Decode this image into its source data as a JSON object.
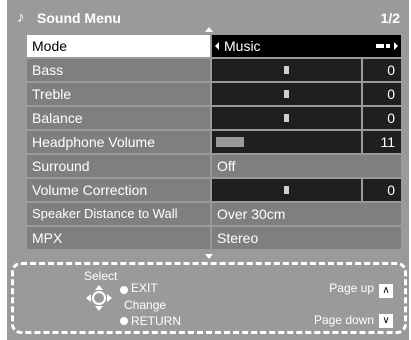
{
  "header": {
    "title": "Sound Menu",
    "page": "1/2",
    "icon": "music-note-icon"
  },
  "menu": {
    "mode": {
      "label": "Mode",
      "value": "Music"
    },
    "bass": {
      "label": "Bass",
      "value": "0"
    },
    "treble": {
      "label": "Treble",
      "value": "0"
    },
    "balance": {
      "label": "Balance",
      "value": "0"
    },
    "headphone": {
      "label": "Headphone Volume",
      "value": "11"
    },
    "surround": {
      "label": "Surround",
      "value": "Off"
    },
    "volcorr": {
      "label": "Volume Correction",
      "value": "0"
    },
    "speaker": {
      "label": "Speaker Distance to Wall",
      "value": "Over 30cm"
    },
    "mpx": {
      "label": "MPX",
      "value": "Stereo"
    }
  },
  "help": {
    "select": "Select",
    "exit": "EXIT",
    "change": "Change",
    "return": "RETURN",
    "page_up": "Page up",
    "page_down": "Page down",
    "page_up_glyph": "∧",
    "page_down_glyph": "∨"
  },
  "colors": {
    "panel": "#9a9a9a",
    "row": "#7f7f7f",
    "slider": "#1f1f1f",
    "selected_label": "#ffffff",
    "selected_value": "#000000"
  }
}
